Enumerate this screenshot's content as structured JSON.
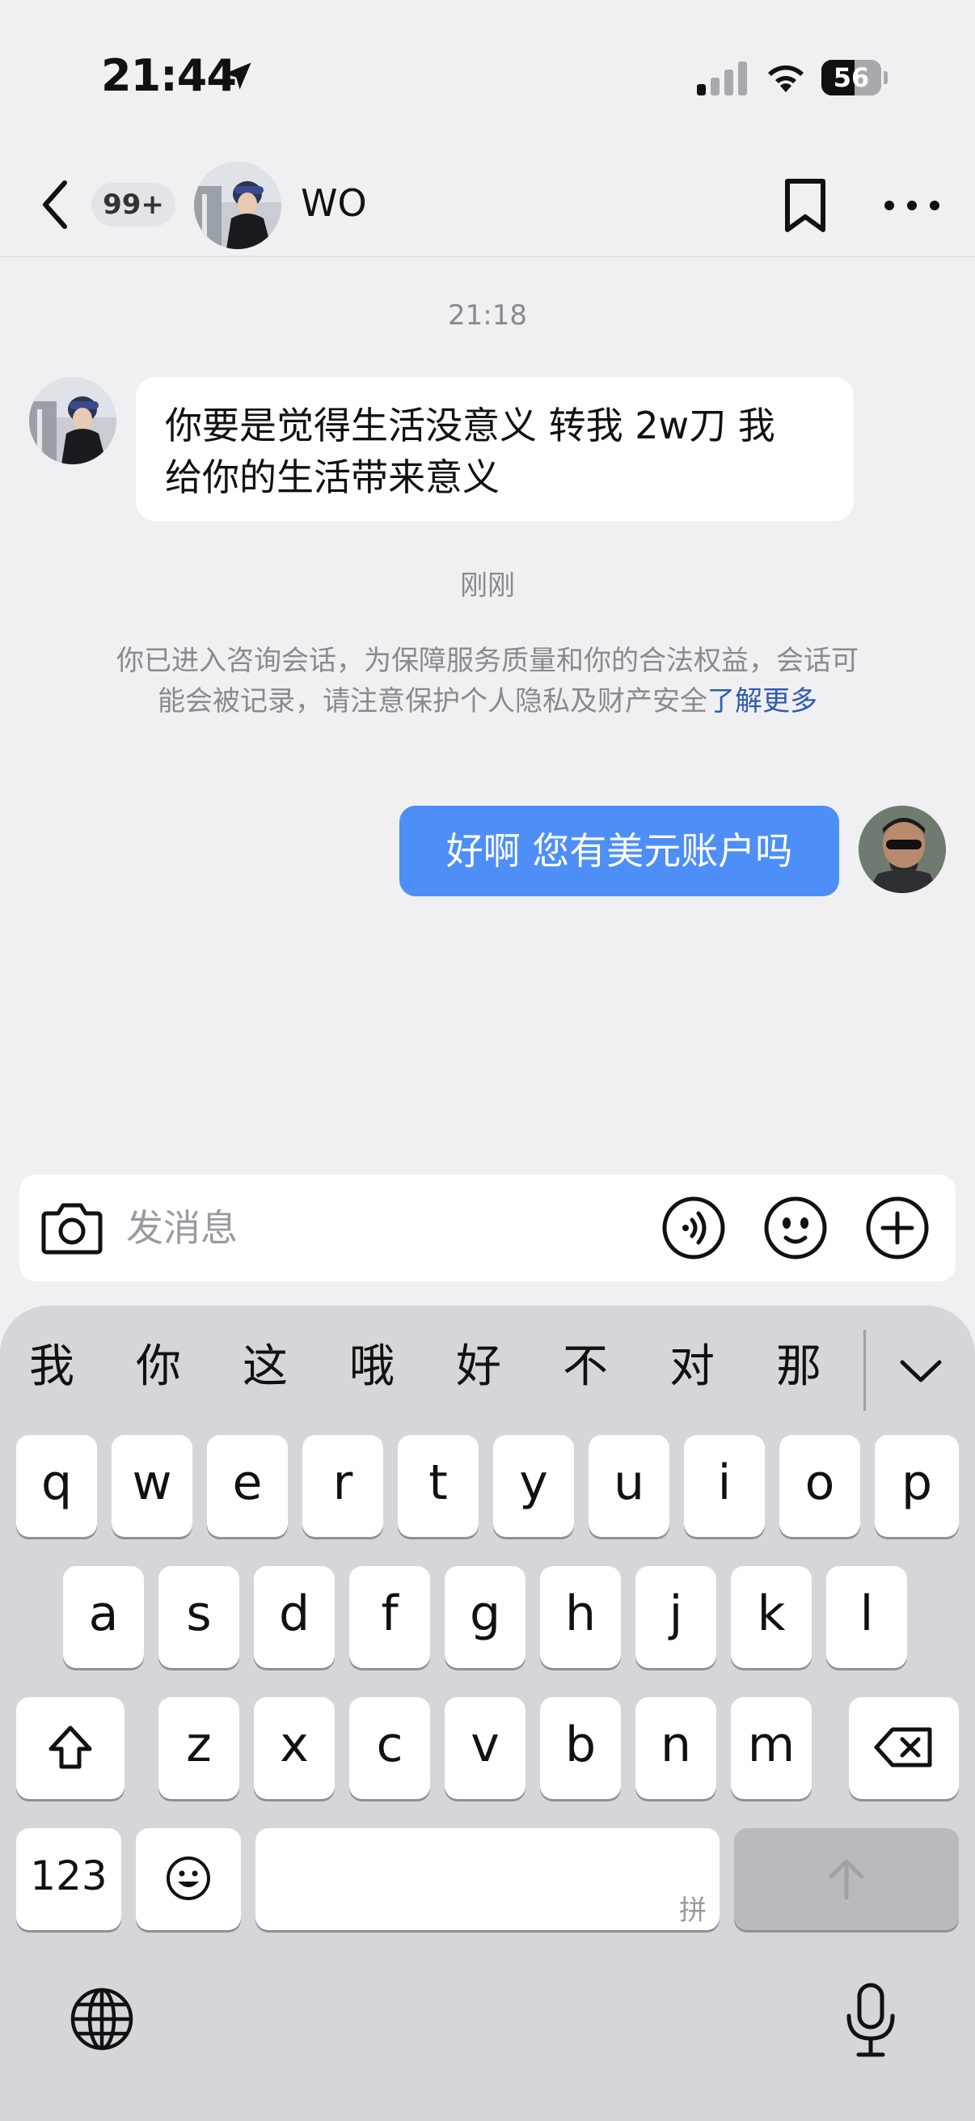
{
  "status_bar": {
    "time": "21:44",
    "battery": "56",
    "battery_level": 0.56
  },
  "header": {
    "unread_badge": "99+",
    "contact_name": "WO"
  },
  "chat": {
    "timestamp_1": "21:18",
    "message_in_line1": "你要是觉得生活没意义 转我 2w刀 我",
    "message_in_line2": "给你的生活带来意义",
    "timestamp_2": "刚刚",
    "notice_text": "你已进入咨询会话，为保障服务质量和你的合法权益，会话可能会被记录，请注意保护个人隐私及财产安全",
    "notice_link": "了解更多",
    "message_out": "好啊 您有美元账户吗"
  },
  "input": {
    "placeholder": "发消息"
  },
  "keyboard": {
    "candidates": [
      "我",
      "你",
      "这",
      "哦",
      "好",
      "不",
      "对",
      "那"
    ],
    "row1": [
      "q",
      "w",
      "e",
      "r",
      "t",
      "y",
      "u",
      "i",
      "o",
      "p"
    ],
    "row2": [
      "a",
      "s",
      "d",
      "f",
      "g",
      "h",
      "j",
      "k",
      "l"
    ],
    "row3": [
      "z",
      "x",
      "c",
      "v",
      "b",
      "n",
      "m"
    ],
    "numbers_key": "123",
    "space_hint": "拼"
  },
  "icons": {
    "location": "location-arrow-icon",
    "back": "back-chevron-icon",
    "bookmark": "bookmark-icon",
    "more": "more-dots-icon",
    "camera": "camera-icon",
    "voice": "voice-icon",
    "emoji": "emoji-face-icon",
    "plus": "plus-icon",
    "shift": "shift-icon",
    "delete": "delete-icon",
    "globe": "globe-icon",
    "mic": "mic-icon"
  },
  "colors": {
    "accent": "#4d8ff6",
    "link": "#2f5bb0",
    "background": "#f0f0f2"
  }
}
